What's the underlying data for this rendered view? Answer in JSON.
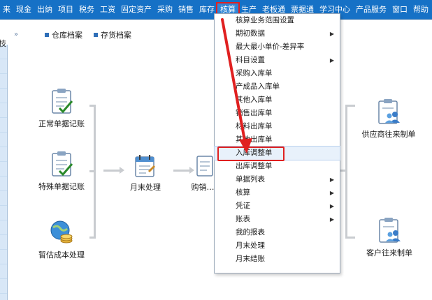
{
  "menubar": {
    "items": [
      "来",
      "现金",
      "出纳",
      "项目",
      "税务",
      "工资",
      "固定资产",
      "采购",
      "销售",
      "库存",
      "核算",
      "生产",
      "老板通",
      "票据通",
      "学习中心",
      "产品服务",
      "窗口",
      "帮助"
    ]
  },
  "tabs": {
    "chevron": "»",
    "items": [
      {
        "label": "仓库档案"
      },
      {
        "label": "存货档案"
      }
    ]
  },
  "leftstrip": {
    "tag": "枝"
  },
  "flow": {
    "nodes": [
      {
        "id": "normal",
        "label": "正常单据记账",
        "icon": "clipboard-check-icon"
      },
      {
        "id": "special",
        "label": "特殊单据记账",
        "icon": "clipboard-check-icon"
      },
      {
        "id": "provisional",
        "label": "暂估成本处理",
        "icon": "globe-coins-icon"
      },
      {
        "id": "monthend",
        "label": "月末处理",
        "icon": "calendar-icon"
      },
      {
        "id": "purchase",
        "label": "购销…",
        "icon": "document-icon"
      },
      {
        "id": "supplier",
        "label": "供应商往来制单",
        "icon": "clipboard-people-icon"
      },
      {
        "id": "customer",
        "label": "客户往来制单",
        "icon": "clipboard-people-icon"
      }
    ]
  },
  "dropdown": {
    "items": [
      {
        "label": "核算业务范围设置",
        "submenu": false
      },
      {
        "label": "期初数据",
        "submenu": true
      },
      {
        "label": "最大最小单价-差异率",
        "submenu": false
      },
      {
        "label": "科目设置",
        "submenu": true
      },
      {
        "label": "采购入库单",
        "submenu": false
      },
      {
        "label": "产成品入库单",
        "submenu": false
      },
      {
        "label": "其他入库单",
        "submenu": false
      },
      {
        "label": "销售出库单",
        "submenu": false
      },
      {
        "label": "材料出库单",
        "submenu": false
      },
      {
        "label": "其他出库单",
        "submenu": false
      },
      {
        "label": "入库调整单",
        "submenu": false,
        "highlighted": true
      },
      {
        "label": "出库调整单",
        "submenu": false
      },
      {
        "label": "单据列表",
        "submenu": true
      },
      {
        "label": "核算",
        "submenu": true
      },
      {
        "label": "凭证",
        "submenu": true
      },
      {
        "label": "账表",
        "submenu": true
      },
      {
        "label": "我的报表",
        "submenu": false
      },
      {
        "label": "月末处理",
        "submenu": false
      },
      {
        "label": "月末结账",
        "submenu": false
      }
    ]
  },
  "colors": {
    "menubar": "#1671c6",
    "annotation": "#e02020",
    "highlight": "#e8f1fb"
  }
}
